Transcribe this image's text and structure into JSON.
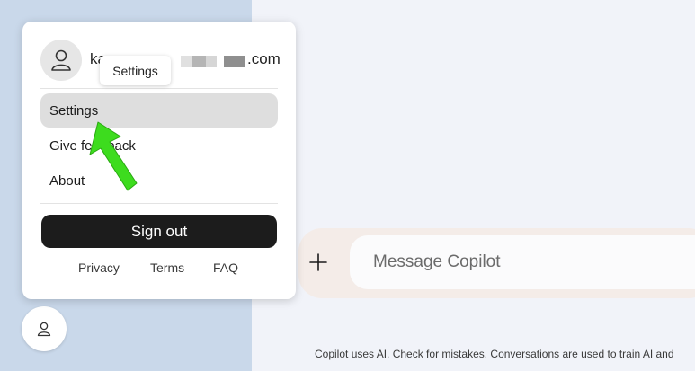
{
  "profile": {
    "email_prefix": "ka",
    "email_suffix": ".com"
  },
  "tooltip": "Settings",
  "menu": {
    "items": [
      {
        "label": "Settings",
        "active": true
      },
      {
        "label": "Give feedback",
        "active": false
      },
      {
        "label": "About",
        "active": false
      }
    ],
    "sign_out_label": "Sign out",
    "footer_links": [
      "Privacy",
      "Terms",
      "FAQ"
    ]
  },
  "composer": {
    "placeholder": "Message Copilot",
    "add_icon": "plus-icon"
  },
  "disclaimer": "Copilot uses AI. Check for mistakes. Conversations are used to train AI and",
  "colors": {
    "sidebar_bg": "#c9d8ea",
    "main_bg": "#f1f3f9",
    "sign_out_bg": "#1c1c1c",
    "active_item_bg": "#dedede",
    "annotation_arrow": "#3ddc1e"
  }
}
